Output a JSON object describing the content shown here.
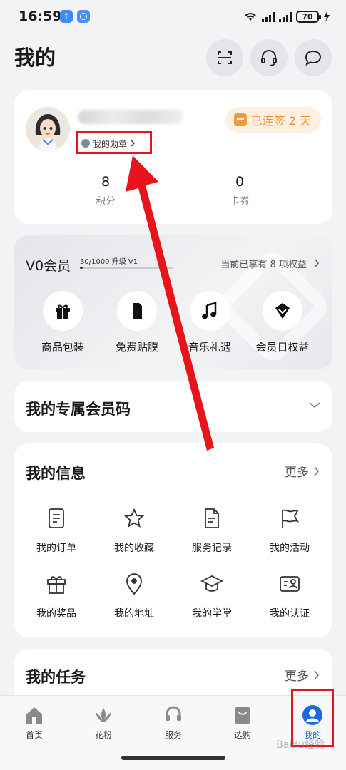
{
  "status_bar": {
    "time": "16:59",
    "battery": "70"
  },
  "header": {
    "title": "我的"
  },
  "profile": {
    "badge_link": "我的勋章",
    "checkin": "已连签 2 天",
    "stats": [
      {
        "value": "8",
        "label": "积分"
      },
      {
        "value": "0",
        "label": "卡券"
      }
    ]
  },
  "membership": {
    "level": "V0会员",
    "progress_text": "30/1000 升级 V1",
    "progress_fraction": 0.03,
    "rights_text": "当前已享有 8 项权益",
    "perks": [
      {
        "label": "商品包装",
        "icon": "gift-icon"
      },
      {
        "label": "免费贴膜",
        "icon": "phone-film-icon"
      },
      {
        "label": "音乐礼遇",
        "icon": "music-note-icon"
      },
      {
        "label": "会员日权益",
        "icon": "diamond-badge-icon"
      }
    ]
  },
  "member_code": {
    "title": "我的专属会员码"
  },
  "my_info": {
    "title": "我的信息",
    "more": "更多",
    "items": [
      {
        "label": "我的订单",
        "icon": "order-list-icon"
      },
      {
        "label": "我的收藏",
        "icon": "star-icon"
      },
      {
        "label": "服务记录",
        "icon": "document-icon"
      },
      {
        "label": "我的活动",
        "icon": "flag-icon"
      },
      {
        "label": "我的奖品",
        "icon": "gift-icon"
      },
      {
        "label": "我的地址",
        "icon": "location-pin-icon"
      },
      {
        "label": "我的学堂",
        "icon": "graduation-cap-icon"
      },
      {
        "label": "我的认证",
        "icon": "id-card-icon"
      }
    ]
  },
  "my_tasks": {
    "title": "我的任务",
    "more": "更多"
  },
  "bottom_nav": {
    "items": [
      {
        "label": "首页",
        "icon": "home-icon"
      },
      {
        "label": "花粉",
        "icon": "flower-icon"
      },
      {
        "label": "服务",
        "icon": "headset-icon"
      },
      {
        "label": "选购",
        "icon": "shopping-bag-icon"
      },
      {
        "label": "我的",
        "icon": "user-icon"
      }
    ],
    "active": "我的"
  },
  "colors": {
    "accent": "#1b6be0",
    "annotation_red": "#e8141b",
    "checkin_orange": "#ef8b2c"
  },
  "watermark": "Baidu经验"
}
